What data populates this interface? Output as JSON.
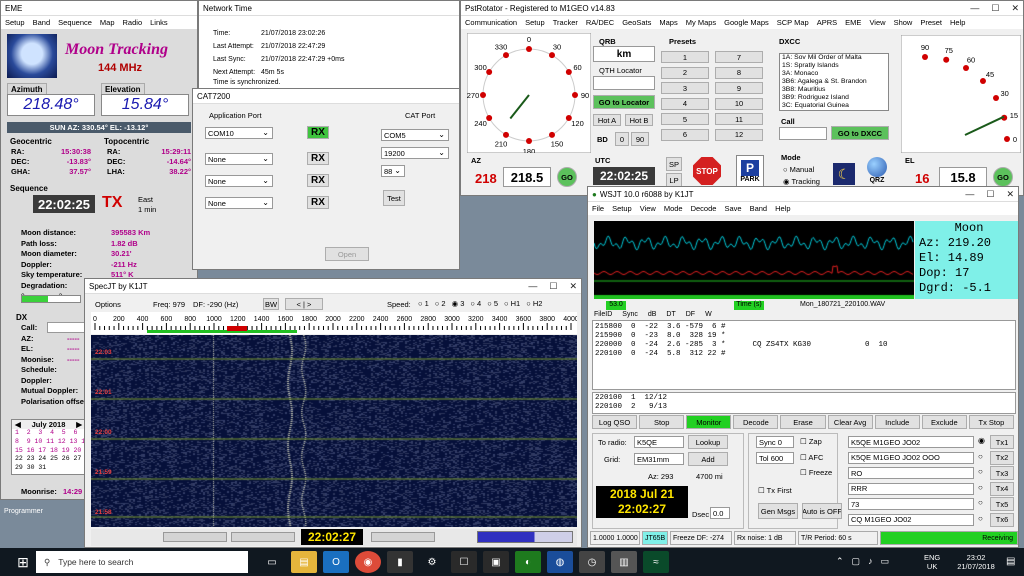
{
  "eme": {
    "title": "EME",
    "menu": [
      "Setup",
      "Band",
      "Sequence",
      "Map",
      "Radio",
      "Links"
    ],
    "heading": "Moon Tracking",
    "freq": "144 MHz",
    "az_label": "Azimuth",
    "az": "218.48°",
    "el_label": "Elevation",
    "el": "15.84°",
    "sun": "SUN   AZ: 330.54°   EL: -13.12°",
    "geo_label": "Geocentric",
    "topo_label": "Topocentric",
    "geo": [
      [
        "RA:",
        "15:30:38"
      ],
      [
        "DEC:",
        "-13.83°"
      ],
      [
        "GHA:",
        "37.57°"
      ]
    ],
    "topo": [
      [
        "RA:",
        "15:29:11"
      ],
      [
        "DEC:",
        "-14.64°"
      ],
      [
        "LHA:",
        "38.22°"
      ]
    ],
    "seq_label": "Sequence",
    "seq_time": "22:02:25",
    "tx": "TX",
    "east": "East",
    "min": "1 min",
    "stats": [
      [
        "Moon distance:",
        "395583 Km"
      ],
      [
        "Path loss:",
        "1.82 dB"
      ],
      [
        "Moon diameter:",
        "30.21'"
      ],
      [
        "Doppler:",
        "-211 Hz"
      ],
      [
        "Sky temperature:",
        "511° K"
      ],
      [
        "Degradation:",
        ""
      ]
    ],
    "deg_ticks": [
      "0",
      "2"
    ],
    "dx_label": "DX",
    "dx_rows": [
      "Call:",
      "AZ:",
      "EL:",
      "Moonise:",
      "Schedule:",
      "Doppler:",
      "Mutual Doppler:",
      "Polarisation offset"
    ],
    "dx_vals": [
      "-----",
      "-----",
      "-----"
    ],
    "cal_month": "July 2018",
    "cal_rows": [
      "1  2  3  4  5  6  7",
      "8  9 10 11 12 13 14",
      "15 16 17 18 19 20 21",
      "22 23 24 25 26 27 28",
      "29 30 31"
    ],
    "moonrise": "Moonrise:",
    "moonrise_val": "14:29"
  },
  "net": {
    "title": "Network Time",
    "rows": [
      [
        "Time:",
        "21/07/2018 23:02:26"
      ],
      [
        "Last Attempt:",
        "21/07/2018 22:47:29"
      ],
      [
        "Last Sync:",
        "21/07/2018 22:47:29 +0ms"
      ],
      [
        "Next Attempt:",
        "45m 5s"
      ]
    ],
    "status": "Time is synchronized."
  },
  "cat": {
    "title": "CAT7200",
    "app_port": "Application Port",
    "cat_port": "CAT Port",
    "app_sel": [
      "COM10",
      "None",
      "None",
      "None"
    ],
    "rx": [
      "RX",
      "RX",
      "RX",
      "RX"
    ],
    "com": "COM5",
    "baud": "19200",
    "addr": "88",
    "test": "Test",
    "open": "Open"
  },
  "pst": {
    "title": "PstRotator - Registered to M1GEO   v14.83",
    "menu": [
      "Communication",
      "Setup",
      "Tracker",
      "RA/DEC",
      "GeoSats",
      "Maps",
      "My Maps",
      "Google Maps",
      "SCP Map",
      "APRS",
      "EME",
      "View",
      "Show",
      "Preset",
      "Help"
    ],
    "dial_labels": [
      "0",
      "30",
      "60",
      "90",
      "120",
      "150",
      "180",
      "210",
      "240",
      "270",
      "300",
      "330"
    ],
    "qrb": "QRB",
    "km": "km",
    "qth": "QTH Locator",
    "goto_loc": "GO to Locator",
    "hot_a": "Hot A",
    "hot_b": "Hot B",
    "bd": "BD",
    "b0": "0",
    "b90": "90",
    "presets_label": "Presets",
    "presets": [
      "1",
      "7",
      "2",
      "8",
      "3",
      "9",
      "4",
      "10",
      "5",
      "11",
      "6",
      "12"
    ],
    "dxcc_label": "DXCC",
    "dxcc": [
      "1A:  Sov Mil Order of Malta",
      "1S:  Spratly Islands",
      "3A:  Monaco",
      "3B6:  Agalega & St. Brandon",
      "3B8:  Mauritius",
      "3B9:  Rodriguez Island",
      "3C:  Equatorial Guinea"
    ],
    "call": "Call",
    "goto_dxcc": "GO to DXCC",
    "az": "AZ",
    "az_val": "218",
    "az_set": "218.5",
    "go": "GO",
    "utc": "UTC",
    "utc_val": "22:02:25",
    "sp": "SP",
    "lp": "LP",
    "stop": "STOP",
    "park": "PARK",
    "mode": "Mode",
    "manual": "Manual",
    "tracking": "Tracking",
    "qrz": "QRZ",
    "el": "EL",
    "el_val": "16",
    "el_set": "15.8",
    "el_labels": [
      "90",
      "75",
      "60",
      "45",
      "30",
      "15",
      "0"
    ]
  },
  "spec": {
    "title": "SpecJT     by K1JT",
    "options": "Options",
    "freq": "Freq:  979",
    "df": "DF:  -290  (Hz)",
    "bw": "BW",
    "speed": "Speed:",
    "speeds": [
      "1",
      "2",
      "3",
      "4",
      "5",
      "H1",
      "H2"
    ],
    "scale": [
      "0",
      "200",
      "400",
      "600",
      "800",
      "1000",
      "1200",
      "1400",
      "1600",
      "1800",
      "2000",
      "2200",
      "2400",
      "2600",
      "2800",
      "3000",
      "3200",
      "3400",
      "3600",
      "3800",
      "4000"
    ],
    "times": [
      "22:03",
      "22:01",
      "22:00",
      "21:59",
      "21:58"
    ],
    "clock": "22:02:27"
  },
  "wsjt": {
    "title": "WSJT 10.0   r6088      by K1JT",
    "menu": [
      "File",
      "Setup",
      "View",
      "Mode",
      "Decode",
      "Save",
      "Band",
      "Help"
    ],
    "moon": [
      "Moon",
      "Az: 219.20",
      "El:  14.89",
      "Dop:     17",
      "Dgrd: -5.1"
    ],
    "db": "53.0",
    "time_s": "Time (s)",
    "wav": "Mon_180721_220100.WAV",
    "cols": [
      "FileID",
      "Sync",
      "dB",
      "DT",
      "DF",
      "W"
    ],
    "lines": [
      "215800  0  -22  3.6 -579  6 #",
      "215900  0  -23  8.0  328 19 *",
      "220000  0  -24  2.6 -285  3 *      CQ ZS4TX KG30            0  10",
      "220100  0  -24  5.8  312 22 #"
    ],
    "avg": [
      "220100  1  12/12",
      "220100  2   9/13"
    ],
    "btns": [
      "Log QSO",
      "Stop",
      "Monitor",
      "Decode",
      "Erase",
      "Clear Avg",
      "Include",
      "Exclude",
      "Tx Stop"
    ],
    "to_radio": "To radio:",
    "to_val": "K5QE",
    "lookup": "Lookup",
    "grid": "Grid:",
    "grid_val": "EM31mm",
    "add": "Add",
    "az": "Az: 293",
    "dist": "4700 mi",
    "date": "2018 Jul 21",
    "clock": "22:02:27",
    "dsec": "Dsec",
    "dsec_val": "0.0",
    "sync": "Sync",
    "sync_val": "0",
    "tol": "Tol",
    "tol_val": "600",
    "zap": "Zap",
    "afc": "AFC",
    "freeze": "Freeze",
    "txfirst": "Tx First",
    "gen": "Gen Msgs",
    "auto": "Auto is OFF",
    "tx": [
      "K5QE M1GEO JO02",
      "K5QE M1GEO JO02 OOO",
      "RO",
      "RRR",
      "73",
      "CQ M1GEO JO02"
    ],
    "txb": [
      "Tx1",
      "Tx2",
      "Tx3",
      "Tx4",
      "Tx5",
      "Tx6"
    ],
    "status": [
      "1.0000  1.0000",
      "JT65B",
      "Freeze DF: -274",
      "Rx noise:  1 dB",
      "T/R Period: 60 s",
      "Receiving"
    ]
  },
  "taskbar": {
    "search": "Type here to search",
    "lang": "ENG",
    "region": "UK",
    "time": "23:02",
    "date": "21/07/2018",
    "programmer": "Programmer"
  }
}
